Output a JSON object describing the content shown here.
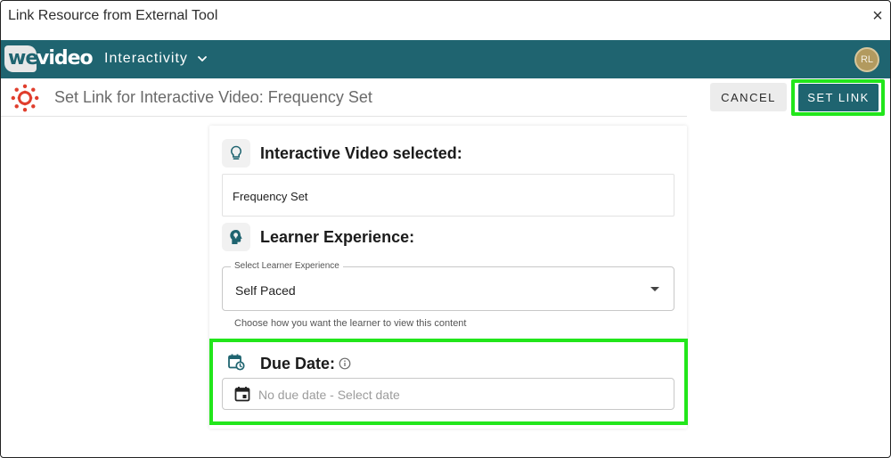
{
  "dialog": {
    "title": "Link Resource from External Tool",
    "close_glyph": "×"
  },
  "header": {
    "logo_we": "we",
    "logo_video": "video",
    "nav_label": "Interactivity",
    "avatar_initials": "RL",
    "background_color": "#1f6470"
  },
  "subheader": {
    "page_title": "Set Link for Interactive Video: Frequency Set",
    "cancel_label": "CANCEL",
    "set_link_label": "SET LINK",
    "highlight_color": "#22e61b"
  },
  "card": {
    "video_section": {
      "icon": "lightbulb-icon",
      "heading": "Interactive Video selected:",
      "selected_value": "Frequency Set"
    },
    "learner_section": {
      "icon": "head-lightbulb-icon",
      "heading": "Learner Experience:",
      "select_label": "Select Learner Experience",
      "select_value": "Self Paced",
      "helper_text": "Choose how you want the learner to view this content"
    },
    "due_section": {
      "icon": "calendar-clock-icon",
      "heading": "Due Date:",
      "info_icon": "info-icon",
      "date_placeholder": "No due date - Select date"
    }
  }
}
